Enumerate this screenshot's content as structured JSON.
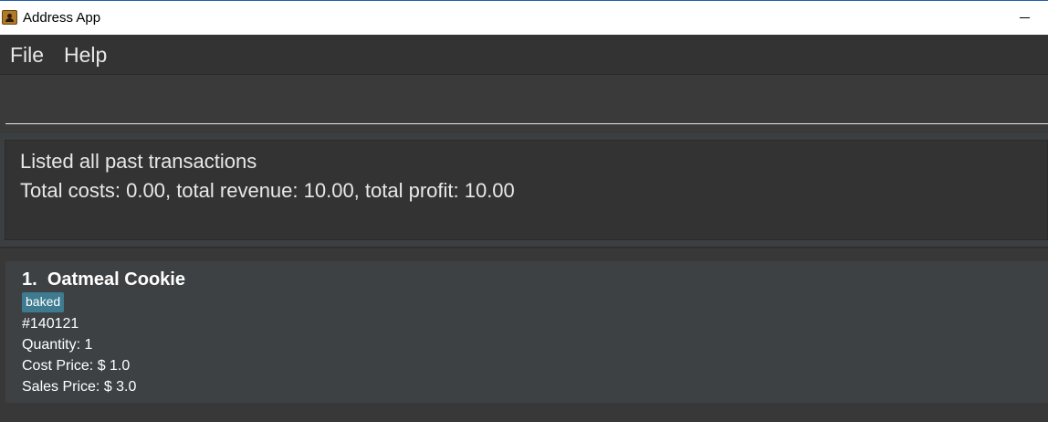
{
  "window": {
    "title": "Address App"
  },
  "menu": {
    "file": "File",
    "help": "Help"
  },
  "command": {
    "value": "",
    "placeholder": ""
  },
  "result": {
    "line1": "Listed all past transactions",
    "line2": "Total costs: 0.00, total revenue: 10.00, total profit: 10.00"
  },
  "transactions": [
    {
      "index": "1.",
      "name": "Oatmeal Cookie",
      "tag": "baked",
      "id": "#140121",
      "quantity": "Quantity: 1",
      "cost_price": "Cost Price: $ 1.0",
      "sales_price": "Sales Price: $ 3.0"
    }
  ],
  "colors": {
    "tag_bg": "#3e7b91",
    "card_bg": "#3e4144",
    "window_bg": "#3c3f41"
  }
}
